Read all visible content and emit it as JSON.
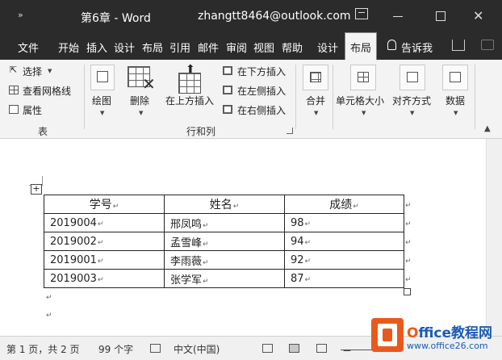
{
  "titlebar": {
    "qat_symbol": "»",
    "doc_title": "第6章 - Word",
    "account": "zhangtt8464@outlook.com"
  },
  "tabs": [
    {
      "label": "文件"
    },
    {
      "label": "开始"
    },
    {
      "label": "插入"
    },
    {
      "label": "设计"
    },
    {
      "label": "布局"
    },
    {
      "label": "引用"
    },
    {
      "label": "邮件"
    },
    {
      "label": "审阅"
    },
    {
      "label": "视图"
    },
    {
      "label": "帮助"
    },
    {
      "label": "设计"
    },
    {
      "label": "布局"
    },
    {
      "label": "告诉我"
    }
  ],
  "active_tab_index": 11,
  "ribbon": {
    "table_group": {
      "select": "选择",
      "view_gridlines": "查看网格线",
      "properties": "属性",
      "label": "表"
    },
    "draw": "绘图",
    "delete": "删除",
    "insert_above": "在上方插入",
    "insert_below": "在下方插入",
    "insert_left": "在左侧插入",
    "insert_right": "在右侧插入",
    "rows_cols_label": "行和列",
    "merge": "合并",
    "cell_size": "单元格大小",
    "alignment": "对齐方式",
    "data": "数据"
  },
  "document": {
    "table": {
      "headers": [
        "学号",
        "姓名",
        "成绩"
      ],
      "rows": [
        [
          "2019004",
          "邢凤鸣",
          "98"
        ],
        [
          "2019002",
          "孟雪峰",
          "94"
        ],
        [
          "2019001",
          "李雨薇",
          "92"
        ],
        [
          "2019003",
          "张学军",
          "87"
        ]
      ]
    },
    "cell_mark": "↵",
    "move_handle_symbol": "+"
  },
  "statusbar": {
    "page": "第 1 页，共 2 页",
    "words": "99 个字",
    "language": "中文(中国)",
    "zoom_minus": "－"
  },
  "watermark": {
    "line1_o": "O",
    "line1_rest": "ffice教程网",
    "line2": "www.office26.com"
  },
  "colors": {
    "titlebar_bg": "#2b2b2b",
    "ribbon_bg": "#f3f3f3",
    "watermark_orange": "#e85a1c",
    "watermark_blue": "#1b5bb5"
  }
}
